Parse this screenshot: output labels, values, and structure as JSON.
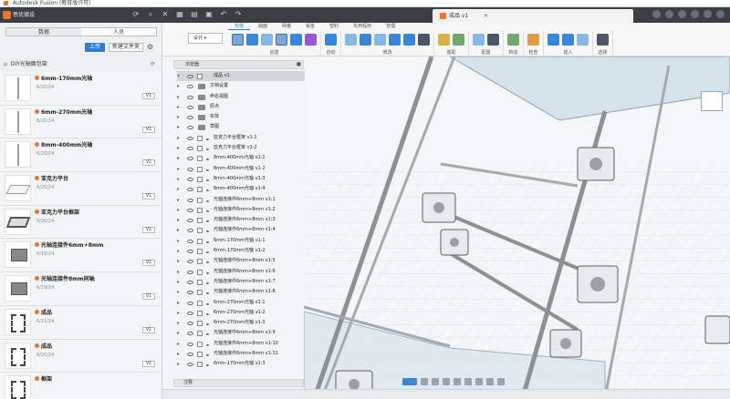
{
  "window": {
    "title": "Autodesk Fusion (教育版许可)"
  },
  "topbar": {
    "team_name": "思优德设",
    "doc_tab": "成品 v1"
  },
  "data_panel": {
    "tabs": [
      "数据",
      "人员"
    ],
    "upload_label": "上传",
    "new_folder_label": "新建文件夹",
    "breadcrumb": "DIY光轴面包架",
    "items": [
      {
        "name": "6mm-170mm光轴",
        "date": "6/20/24",
        "version": "V1",
        "thumb": "rod"
      },
      {
        "name": "6mm-270mm光轴",
        "date": "6/20/24",
        "version": "V1",
        "thumb": "rod"
      },
      {
        "name": "8mm-400mm光轴",
        "date": "6/20/24",
        "version": "V1",
        "thumb": "rod"
      },
      {
        "name": "亚克力平台",
        "date": "6/20/24",
        "version": "V1",
        "thumb": "plate"
      },
      {
        "name": "亚克力平台框架",
        "date": "6/20/24",
        "version": "V1",
        "thumb": "frame"
      },
      {
        "name": "光轴连接件6mm+8mm",
        "date": "6/19/24",
        "version": "V1",
        "thumb": "block"
      },
      {
        "name": "光轴连接件8mm同轴",
        "date": "6/19/24",
        "version": "V1",
        "thumb": "block"
      },
      {
        "name": "成品",
        "date": "6/21/24",
        "version": "V1",
        "thumb": "cube"
      },
      {
        "name": "成品",
        "date": "6/20/24",
        "version": "V1",
        "thumb": "cube"
      },
      {
        "name": "框架",
        "date": "",
        "version": "",
        "thumb": "cube"
      }
    ]
  },
  "ribbon": {
    "workspace": "设计",
    "tabs": [
      "实体",
      "曲面",
      "网格",
      "钣金",
      "塑料",
      "实用程序",
      "管理"
    ],
    "groups": [
      "创建",
      "自动",
      "修改",
      "装配",
      "配置",
      "构造",
      "检查",
      "插入",
      "选择"
    ]
  },
  "browser": {
    "header": "浏览器",
    "root": "成品 v1",
    "rows": [
      {
        "type": "folder",
        "label": "文档设置"
      },
      {
        "type": "folder",
        "label": "命名视图"
      },
      {
        "type": "folder",
        "label": "原点"
      },
      {
        "type": "folder",
        "label": "实体"
      },
      {
        "type": "folder",
        "label": "草图"
      },
      {
        "type": "link",
        "label": "亚克力平台框架 v1:1"
      },
      {
        "type": "link",
        "label": "亚克力平台框架 v1:2"
      },
      {
        "type": "link",
        "label": "8mm-400mm光轴 v1:1"
      },
      {
        "type": "link",
        "label": "8mm-400mm光轴 v1:2"
      },
      {
        "type": "link",
        "label": "8mm-400mm光轴 v1:3"
      },
      {
        "type": "link",
        "label": "8mm-400mm光轴 v1:4"
      },
      {
        "type": "link",
        "label": "光轴连接件6mm+8mm v1:1"
      },
      {
        "type": "link",
        "label": "光轴连接件6mm+8mm v1:2"
      },
      {
        "type": "link",
        "label": "光轴连接件6mm+8mm v1:3"
      },
      {
        "type": "link",
        "label": "光轴连接件6mm+8mm v1:4"
      },
      {
        "type": "link",
        "label": "6mm-170mm光轴 v1:1"
      },
      {
        "type": "link",
        "label": "6mm-170mm光轴 v1:2"
      },
      {
        "type": "link",
        "label": "光轴连接件6mm+8mm v1:5"
      },
      {
        "type": "link",
        "label": "光轴连接件6mm+8mm v1:6"
      },
      {
        "type": "link",
        "label": "光轴连接件6mm+8mm v1:7"
      },
      {
        "type": "link",
        "label": "光轴连接件6mm+8mm v1:8"
      },
      {
        "type": "link",
        "label": "6mm-270mm光轴 v1:1"
      },
      {
        "type": "link",
        "label": "6mm-270mm光轴 v1:2"
      },
      {
        "type": "link",
        "label": "6mm-270mm光轴 v1:3"
      },
      {
        "type": "link",
        "label": "光轴连接件6mm+8mm v1:9"
      },
      {
        "type": "link",
        "label": "光轴连接件6mm+8mm v1:10"
      },
      {
        "type": "link",
        "label": "光轴连接件6mm+8mm v1:11"
      },
      {
        "type": "link",
        "label": "6mm-170mm光轴 v1:3"
      }
    ]
  },
  "bottom": {
    "comments_label": "注释"
  },
  "colors": {
    "accent": "#2d7dd6",
    "brand": "#e8762d",
    "toolbar": "#3b3f45"
  }
}
